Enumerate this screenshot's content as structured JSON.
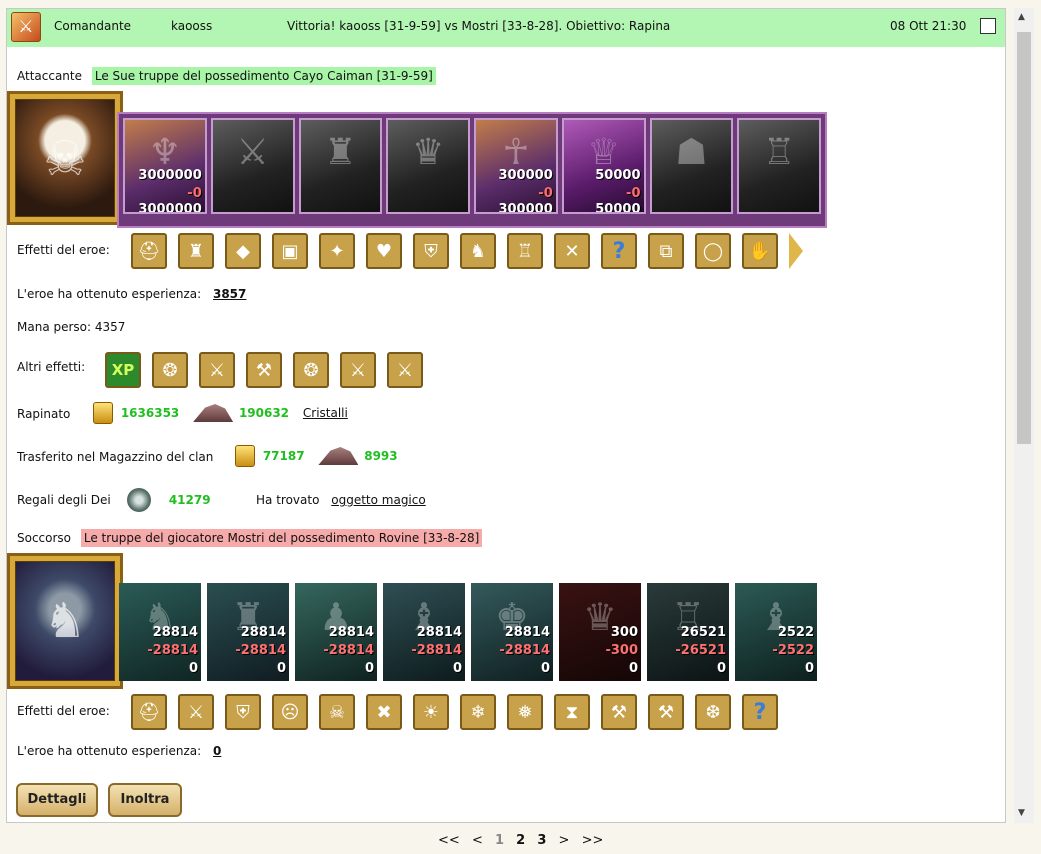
{
  "header": {
    "type": "Comandante",
    "player": "kaooss",
    "summary": "Vittoria! kaooss [31-9-59] vs Mostri [33-8-28]. Obiettivo: Rapina",
    "date": "08 Ott 21:30",
    "icon": "crossed-swords-icon"
  },
  "attacker": {
    "label": "Attaccante",
    "troops": "Le Sue truppe del possedimento Cayo Caiman [31-9-59]",
    "units": [
      {
        "style": "color",
        "a": "3000000",
        "b": "-0",
        "c": "3000000"
      },
      {
        "style": "gray",
        "a": "",
        "b": "",
        "c": ""
      },
      {
        "style": "gray",
        "a": "",
        "b": "",
        "c": ""
      },
      {
        "style": "gray",
        "a": "",
        "b": "",
        "c": ""
      },
      {
        "style": "color",
        "a": "300000",
        "b": "-0",
        "c": "300000"
      },
      {
        "style": "color2",
        "a": "50000",
        "b": "-0",
        "c": "50000"
      },
      {
        "style": "gray",
        "a": "",
        "b": "",
        "c": ""
      },
      {
        "style": "gray",
        "a": "",
        "b": "",
        "c": ""
      }
    ],
    "effects_label": "Effetti del eroe:",
    "exp_label": "L'eroe ha ottenuto esperienza:",
    "exp_value": "3857",
    "mana_text": "Mana perso: 4357",
    "other_label": "Altri effetti:",
    "other_first": "XP"
  },
  "loot": {
    "robbed_label": "Rapinato",
    "robbed_gold": "1636353",
    "robbed_crystals": "190632",
    "crystals_link": "Cristalli",
    "clan_label": "Trasferito nel Magazzino del clan",
    "clan_gold": "77187",
    "clan_crystals": "8993",
    "gods_label": "Regali degli Dei",
    "gods_value": "41279",
    "found_label": "Ha trovato",
    "found_link": "oggetto magico"
  },
  "defender": {
    "label": "Soccorso",
    "troops": "Le truppe del giocatore Mostri del possedimento Rovine [33-8-28]",
    "units": [
      {
        "a": "28814",
        "b": "-28814",
        "c": "0"
      },
      {
        "a": "28814",
        "b": "-28814",
        "c": "0"
      },
      {
        "a": "28814",
        "b": "-28814",
        "c": "0"
      },
      {
        "a": "28814",
        "b": "-28814",
        "c": "0"
      },
      {
        "a": "28814",
        "b": "-28814",
        "c": "0"
      },
      {
        "a": "300",
        "b": "-300",
        "c": "0"
      },
      {
        "a": "26521",
        "b": "-26521",
        "c": "0"
      },
      {
        "a": "2522",
        "b": "-2522",
        "c": "0"
      }
    ],
    "effects_label": "Effetti del eroe:",
    "exp_label": "L'eroe ha ottenuto esperienza:",
    "exp_value": "0"
  },
  "buttons": {
    "details": "Dettagli",
    "forward": "Inoltra"
  },
  "pager": {
    "first": "<<",
    "prev": "<",
    "p1": "1",
    "p2": "2",
    "p3": "3",
    "next": ">",
    "last": ">>"
  }
}
